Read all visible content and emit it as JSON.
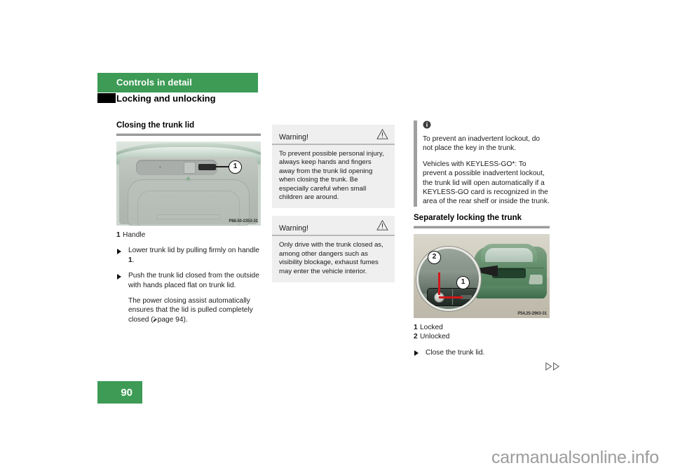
{
  "header": {
    "chapter_title": "Controls in detail",
    "section_title": "Locking and unlocking",
    "band_color": "#3d9b55"
  },
  "left_column": {
    "heading": "Closing the trunk lid",
    "figure": {
      "code": "P88.50-2353-31",
      "callouts": [
        "1"
      ]
    },
    "legend": [
      {
        "num": "1",
        "text": "Handle"
      }
    ],
    "bullets": [
      {
        "text_before": "Lower trunk lid by pulling firmly on handle ",
        "bold": "1",
        "text_after": "."
      },
      {
        "text_before": "Push the trunk lid closed from the outside with hands placed flat on trunk lid.",
        "bold": "",
        "text_after": ""
      }
    ],
    "paragraph_before": "The power closing assist automatically ensures that the lid is pulled completely closed (",
    "paragraph_ref": "page 94",
    "paragraph_after": ")."
  },
  "middle_column": {
    "warnings": [
      {
        "label": "Warning!",
        "icon": "warning-triangle-icon",
        "text": "To prevent possible personal injury, always keep hands and fingers away from the trunk lid opening when closing the trunk. Be especially careful when small children are around."
      },
      {
        "label": "Warning!",
        "icon": "warning-triangle-icon",
        "text": "Only drive with the trunk closed as, among other dangers such as visibility blockage, exhaust fumes may enter the vehicle interior."
      }
    ]
  },
  "right_column": {
    "note": {
      "icon": "info-icon",
      "paragraphs": [
        "To prevent an inadvertent lockout, do not place the key in the trunk.",
        "Vehicles with KEYLESS-GO*: To prevent a possible inadvertent lockout, the trunk lid will open automatically if a KEYLESS-GO card is recognized in the area of the rear shelf or inside the trunk."
      ]
    },
    "heading": "Separately locking the trunk",
    "figure": {
      "code": "P54.25-2963-31",
      "callouts": [
        "1",
        "2"
      ]
    },
    "legend": [
      {
        "num": "1",
        "text": "Locked"
      },
      {
        "num": "2",
        "text": "Unlocked"
      }
    ],
    "bullets": [
      {
        "text": "Close the trunk lid."
      }
    ]
  },
  "footer": {
    "page_number": "90",
    "watermark": "carmanualsonline.info",
    "continuation_icon": "double-arrow-continuation-icon"
  }
}
